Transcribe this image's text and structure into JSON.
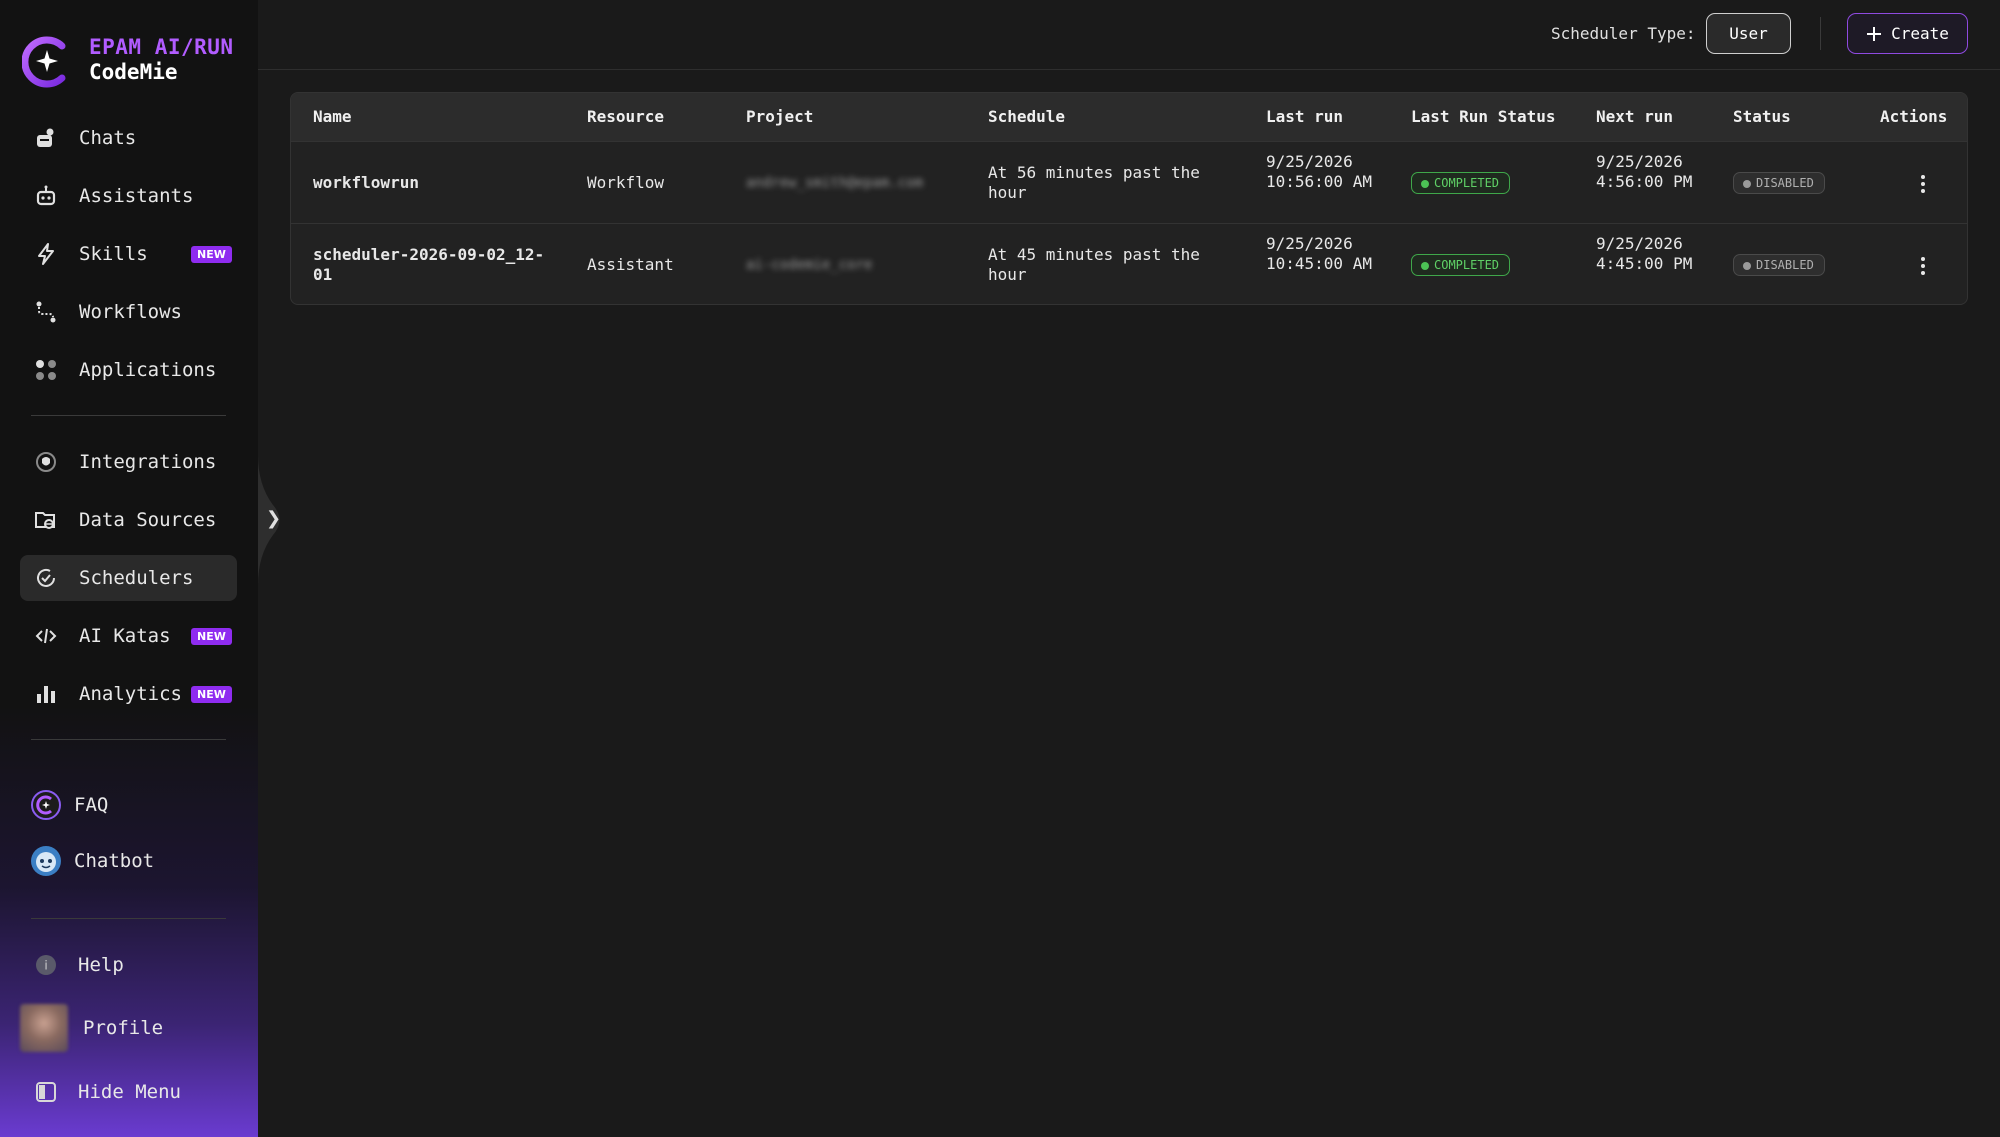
{
  "brand": {
    "top": "EPAM AI/RUN",
    "bottom": "CodeMie",
    "accent": "#b15cff"
  },
  "nav": {
    "primary": [
      {
        "label": "Chats",
        "icon": "chats-icon"
      },
      {
        "label": "Assistants",
        "icon": "robot-icon"
      },
      {
        "label": "Skills",
        "icon": "lightning-icon",
        "badge": "NEW"
      },
      {
        "label": "Workflows",
        "icon": "workflow-icon"
      },
      {
        "label": "Applications",
        "icon": "apps-icon"
      }
    ],
    "secondary": [
      {
        "label": "Integrations",
        "icon": "integrations-icon"
      },
      {
        "label": "Data Sources",
        "icon": "data-sources-icon"
      },
      {
        "label": "Schedulers",
        "icon": "scheduler-icon",
        "active": true
      },
      {
        "label": "AI Katas",
        "icon": "code-icon",
        "badge": "NEW"
      },
      {
        "label": "Analytics",
        "icon": "bar-chart-icon",
        "badge": "NEW"
      }
    ],
    "support": [
      {
        "label": "FAQ",
        "icon": "faq-icon"
      },
      {
        "label": "Chatbot",
        "icon": "chatbot-icon"
      }
    ],
    "footer": [
      {
        "label": "Help",
        "icon": "info-icon"
      },
      {
        "label": "Profile",
        "icon": "avatar"
      },
      {
        "label": "Hide Menu",
        "icon": "hide-menu-icon"
      }
    ]
  },
  "header": {
    "scheduler_type_label": "Scheduler Type:",
    "scheduler_type_value": "User",
    "create_label": "Create"
  },
  "table": {
    "columns": [
      "Name",
      "Resource",
      "Project",
      "Schedule",
      "Last run",
      "Last Run Status",
      "Next run",
      "Status",
      "Actions"
    ],
    "rows": [
      {
        "name": "workflowrun",
        "resource": "Workflow",
        "project": "andrew_smith@epam.com",
        "schedule": "At 56 minutes past the hour",
        "last_run": "9/25/2026 10:56:00 AM",
        "last_run_status": "COMPLETED",
        "next_run": "9/25/2026 4:56:00 PM",
        "status": "DISABLED"
      },
      {
        "name": "scheduler-2026-09-02_12-01",
        "resource": "Assistant",
        "project": "ai-codemie_core",
        "schedule": "At 45 minutes past the hour",
        "last_run": "9/25/2026 10:45:00 AM",
        "last_run_status": "COMPLETED",
        "next_run": "9/25/2026 4:45:00 PM",
        "status": "DISABLED"
      }
    ]
  }
}
